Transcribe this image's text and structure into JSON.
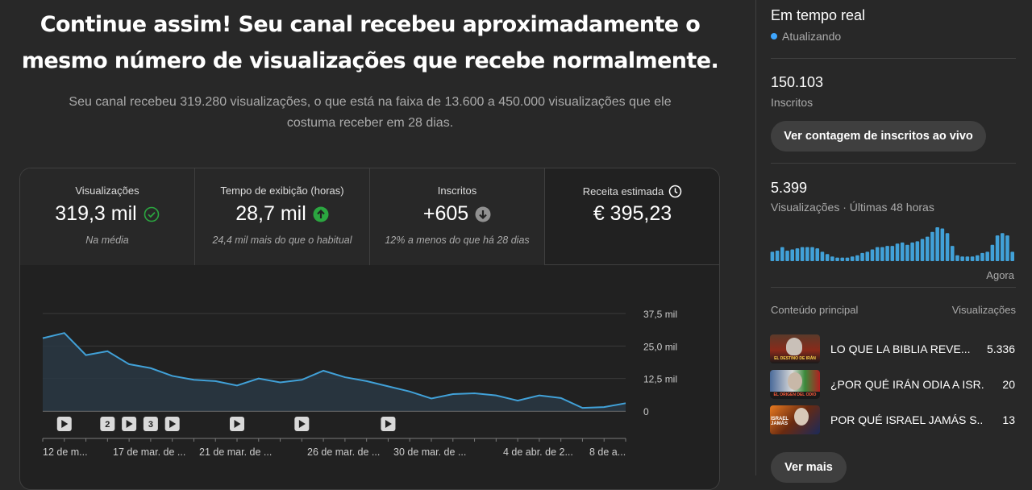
{
  "headline": {
    "line1": "Continue assim! Seu canal recebeu aproximadamente o",
    "line2": "mesmo número de visualizações que recebe normalmente."
  },
  "subline": {
    "line1": "Seu canal recebeu 319.280 visualizações, o que está na faixa de 13.600 a 450.000 visualizações que ele",
    "line2": "costuma receber em 28 dias."
  },
  "metrics": [
    {
      "label": "Visualizações",
      "value": "319,3 mil",
      "note": "Na média",
      "icon": "check-circle-icon",
      "color": "#2ba640"
    },
    {
      "label": "Tempo de exibição (horas)",
      "value": "28,7 mil",
      "note": "24,4 mil mais do que o habitual",
      "icon": "arrow-up-circle-icon",
      "color": "#2ba640"
    },
    {
      "label": "Inscritos",
      "value": "+605",
      "note": "12% a menos do que há 28 dias",
      "icon": "arrow-down-circle-icon",
      "color": "#909090"
    },
    {
      "label": "Receita estimada",
      "value": "€ 395,23",
      "note": "",
      "icon": "clock-icon"
    }
  ],
  "chart_data": {
    "type": "area",
    "series": [
      {
        "values": [
          28,
          30,
          21.5,
          23,
          18,
          16.5,
          13.5,
          12,
          11.5,
          9.8,
          12.5,
          11,
          12,
          15.5,
          13,
          11.5,
          9.5,
          7.5,
          4.8,
          6.5,
          6.8,
          6,
          4,
          6,
          5,
          1.2,
          1.5,
          3
        ]
      }
    ],
    "y_ticks": [
      "37,5 mil",
      "25,0 mil",
      "12,5 mil",
      "0"
    ],
    "ylim": [
      0,
      37.5
    ],
    "x_tick_labels": [
      "12 de m...",
      "17 de mar. de ...",
      "21 de mar. de ...",
      "26 de mar. de ...",
      "30 de mar. de ...",
      "4 de abr. de 2...",
      "8 de a..."
    ],
    "markers": [
      {
        "kind": "play",
        "label": ""
      },
      {
        "kind": "number",
        "label": "2"
      },
      {
        "kind": "play",
        "label": ""
      },
      {
        "kind": "number",
        "label": "3"
      },
      {
        "kind": "play",
        "label": ""
      },
      {
        "kind": "play",
        "label": ""
      },
      {
        "kind": "play",
        "label": ""
      },
      {
        "kind": "play",
        "label": ""
      }
    ],
    "colors": {
      "line": "#41a1d8",
      "fill": "#2b3a46"
    }
  },
  "realtime": {
    "title": "Em tempo real",
    "status": "Atualizando",
    "subscribers": "150.103",
    "subscribers_label": "Inscritos",
    "live_button": "Ver contagem de inscritos ao vivo",
    "views": "5.399",
    "views_label": "Visualizações · Últimas 48 horas",
    "now_label": "Agora",
    "bars": [
      8,
      9,
      12,
      9,
      10,
      11,
      12,
      12,
      12,
      11,
      8,
      6,
      4,
      3,
      3,
      3,
      4,
      5,
      7,
      8,
      10,
      12,
      12,
      13,
      13,
      15,
      16,
      14,
      16,
      17,
      19,
      21,
      25,
      29,
      28,
      24,
      13,
      5,
      4,
      4,
      4,
      5,
      7,
      8,
      14,
      22,
      24,
      22,
      8
    ],
    "bar_color": "#41a1d8",
    "top_content_label": "Conteúdo principal",
    "views_col_label": "Visualizações",
    "videos": [
      {
        "title": "LO QUE LA BIBLIA REVE...",
        "views": "5.336",
        "thumb_caption": "EL DESTINO DE IRÁN"
      },
      {
        "title": "¿POR QUÉ IRÁN ODIA A ISR...",
        "views": "20",
        "thumb_caption": "EL ORIGEN DEL ODIO"
      },
      {
        "title": "POR QUÉ ISRAEL JAMÁS S...",
        "views": "13",
        "thumb_caption": "ISRAEL JAMÁS"
      }
    ],
    "more_button": "Ver mais"
  }
}
